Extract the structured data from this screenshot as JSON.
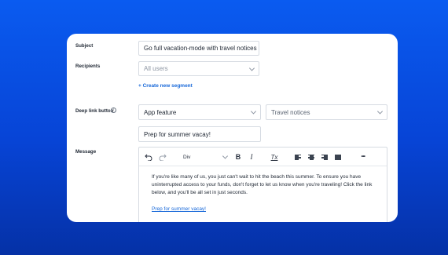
{
  "form": {
    "subject": {
      "label": "Subject",
      "value": "Go full vacation-mode with travel notices"
    },
    "recipients": {
      "label": "Recipients",
      "placeholder": "All users",
      "create_link": "+ Create new segment"
    },
    "deep_link": {
      "label": "Deep link button",
      "feature_select": "App feature",
      "target_select": "Travel notices",
      "button_text": "Prep for summer vacay!"
    },
    "message": {
      "label": "Message"
    }
  },
  "editor": {
    "toolbar": {
      "undo_icon": "undo-icon",
      "redo_icon": "redo-icon",
      "block_format": "Div",
      "bold": "B",
      "italic": "I",
      "clear_format": "Tx",
      "more": "•••"
    },
    "body": "If you're like many of us, you just can't wait to hit the beach this summer. To ensure you have uninterrupted access to your funds, don't forget to let us know when you're traveling! Click the link below, and you'll be all set in just seconds.",
    "link_text": "Prep for summer vacay!"
  },
  "colors": {
    "background": "#0744d6",
    "accent_link": "#1768d9"
  }
}
